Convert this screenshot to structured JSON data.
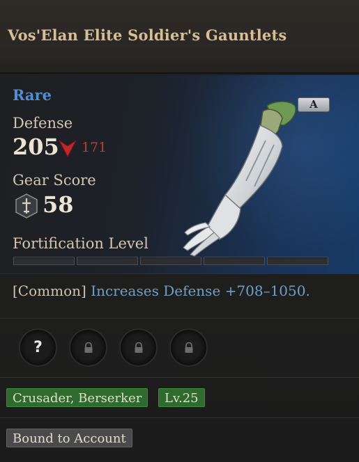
{
  "item": {
    "name": "Vos'Elan Elite Soldier's Gauntlets",
    "rarity": "Rare",
    "grade": "A"
  },
  "stats": {
    "defense_label": "Defense",
    "defense_value": "205",
    "defense_diff": "171",
    "gear_score_label": "Gear Score",
    "gear_score_value": "58",
    "fortification_label": "Fortification Level",
    "fortification_level": 0,
    "fortification_max": 5
  },
  "effect": {
    "rarity_tag": "[Common]",
    "text": "Increases Defense +708–1050."
  },
  "sockets": [
    {
      "state": "empty",
      "icon": "question-icon",
      "symbol": "?"
    },
    {
      "state": "locked",
      "icon": "lock-icon"
    },
    {
      "state": "locked",
      "icon": "lock-icon"
    },
    {
      "state": "locked",
      "icon": "lock-icon"
    }
  ],
  "tags": {
    "classes": "Crusader, Berserker",
    "level": "Lv.25",
    "binding": "Bound to Account"
  },
  "colors": {
    "rarity": "#4f8fd6",
    "title": "#d6bf96",
    "decrease": "#c93a30",
    "effect_text": "#6ea0c8",
    "tag_green": "#2f6b2e"
  }
}
